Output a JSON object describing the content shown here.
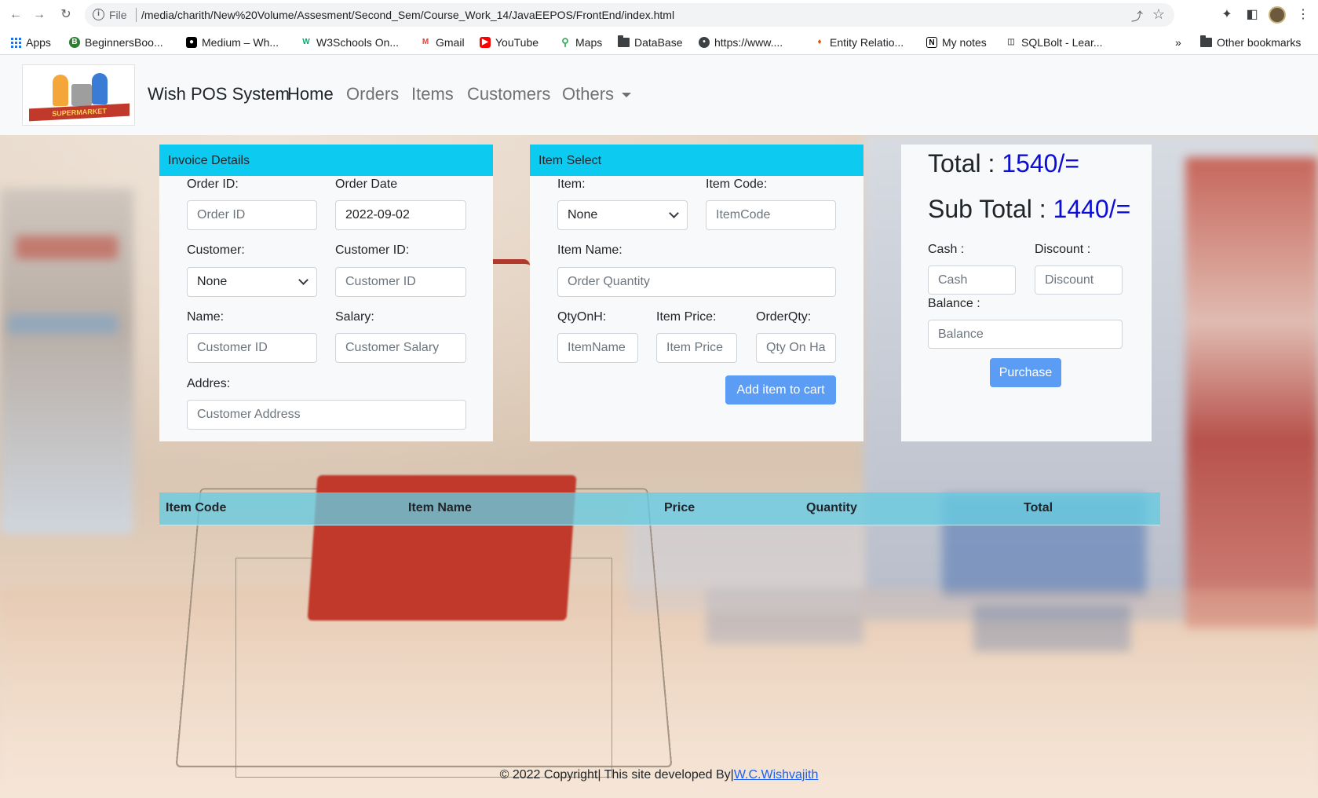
{
  "browser": {
    "scheme": "File",
    "url": "/media/charith/New%20Volume/Assesment/Second_Sem/Course_Work_14/JavaEEPOS/FrontEnd/index.html",
    "bookmarks": [
      {
        "label": "Apps",
        "icon": "apps-grid-icon"
      },
      {
        "label": "BeginnersBoo...",
        "icon": "beginnersbook-icon"
      },
      {
        "label": "Medium – Wh...",
        "icon": "medium-icon"
      },
      {
        "label": "W3Schools On...",
        "icon": "w3schools-icon"
      },
      {
        "label": "Gmail",
        "icon": "gmail-icon"
      },
      {
        "label": "YouTube",
        "icon": "youtube-icon"
      },
      {
        "label": "Maps",
        "icon": "maps-icon"
      },
      {
        "label": "DataBase",
        "icon": "folder-icon"
      },
      {
        "label": "https://www....",
        "icon": "globe-icon"
      },
      {
        "label": "Entity Relatio...",
        "icon": "entity-icon"
      },
      {
        "label": "My notes",
        "icon": "notion-icon"
      },
      {
        "label": "SQLBolt - Lear...",
        "icon": "database-icon"
      }
    ],
    "overflow": "»",
    "other_bookmarks": "Other bookmarks"
  },
  "navbar": {
    "logo_text": "SUPERMARKET",
    "brand": "Wish POS System",
    "links": [
      "Home",
      "Orders",
      "Items",
      "Customers",
      "Others"
    ]
  },
  "invoice": {
    "header": "Invoice Details",
    "order_id_label": "Order ID:",
    "order_id_placeholder": "Order ID",
    "order_date_label": "Order Date",
    "order_date_value": "2022-09-02",
    "customer_label": "Customer:",
    "customer_selected": "None",
    "customer_id_label": "Customer ID:",
    "customer_id_placeholder": "Customer ID",
    "name_label": "Name:",
    "name_placeholder": "Customer ID",
    "salary_label": "Salary:",
    "salary_placeholder": "Customer Salary",
    "address_label": "Addres:",
    "address_placeholder": "Customer Address"
  },
  "item_select": {
    "header": "Item Select",
    "item_label": "Item:",
    "item_selected": "None",
    "item_code_label": "Item Code:",
    "item_code_placeholder": "ItemCode",
    "item_name_label": "Item Name:",
    "item_name_placeholder": "Order Quantity",
    "qty_on_hand_label": "QtyOnH:",
    "qty_on_hand_placeholder": "ItemName",
    "item_price_label": "Item Price:",
    "item_price_placeholder": "Item Price",
    "order_qty_label": "OrderQty:",
    "order_qty_placeholder": "Qty On Hand",
    "add_button": "Add item to cart"
  },
  "summary": {
    "total_label": "Total :",
    "total_value": "1540/=",
    "sub_total_label": "Sub Total :",
    "sub_total_value": "1440/=",
    "cash_label": "Cash :",
    "cash_placeholder": "Cash",
    "discount_label": "Discount :",
    "discount_placeholder": "Discount",
    "balance_label": "Balance :",
    "balance_placeholder": "Balance",
    "purchase_button": "Purchase"
  },
  "cart_table": {
    "columns": [
      "Item Code",
      "Item Name",
      "Price",
      "Quantity",
      "Total"
    ],
    "rows": []
  },
  "footer": {
    "text": "© 2022 Copyright| This site developed By|",
    "author": "W.C.Wishvajith"
  },
  "colors": {
    "card_header": "#0dcaf0",
    "primary_button": "#5b9cf5",
    "amount": "#0d0dd8",
    "table_header": "#66cce2"
  }
}
